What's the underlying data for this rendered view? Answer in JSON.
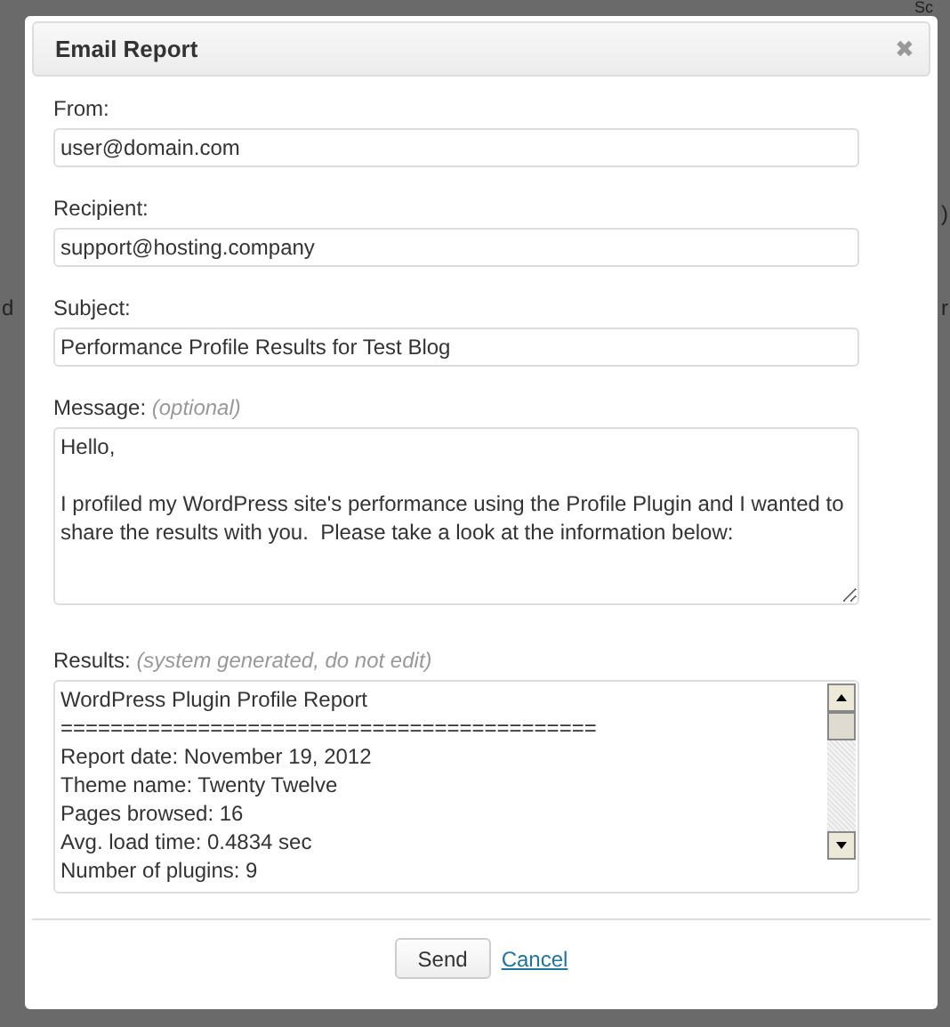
{
  "background_fragments": [
    "Sc",
    ")",
    "d",
    "r"
  ],
  "dialog": {
    "title": "Email Report",
    "close": "✖",
    "fields": [
      {
        "kind": "input",
        "label": "From:",
        "value": "user@domain.com"
      },
      {
        "kind": "input",
        "label": "Recipient:",
        "value": "support@hosting.company"
      },
      {
        "kind": "input",
        "label": "Subject:",
        "value": "Performance Profile Results for Test Blog"
      },
      {
        "kind": "textarea",
        "label": "Message:",
        "note": "(optional)",
        "value": "Hello,\n\nI profiled my WordPress site's performance using the Profile Plugin and I wanted to share the results with you.  Please take a look at the information below:"
      },
      {
        "kind": "readonly",
        "label": "Results:",
        "note": "(system generated, do not edit)",
        "lines": [
          "WordPress Plugin Profile Report",
          "===========================================",
          "Report date: November 19, 2012",
          "Theme name: Twenty Twelve",
          "Pages browsed: 16",
          "Avg. load time: 0.4834 sec",
          "Number of plugins: 9"
        ]
      }
    ],
    "buttons": [
      {
        "kind": "button",
        "label": "Send"
      },
      {
        "kind": "link",
        "label": "Cancel"
      }
    ]
  }
}
